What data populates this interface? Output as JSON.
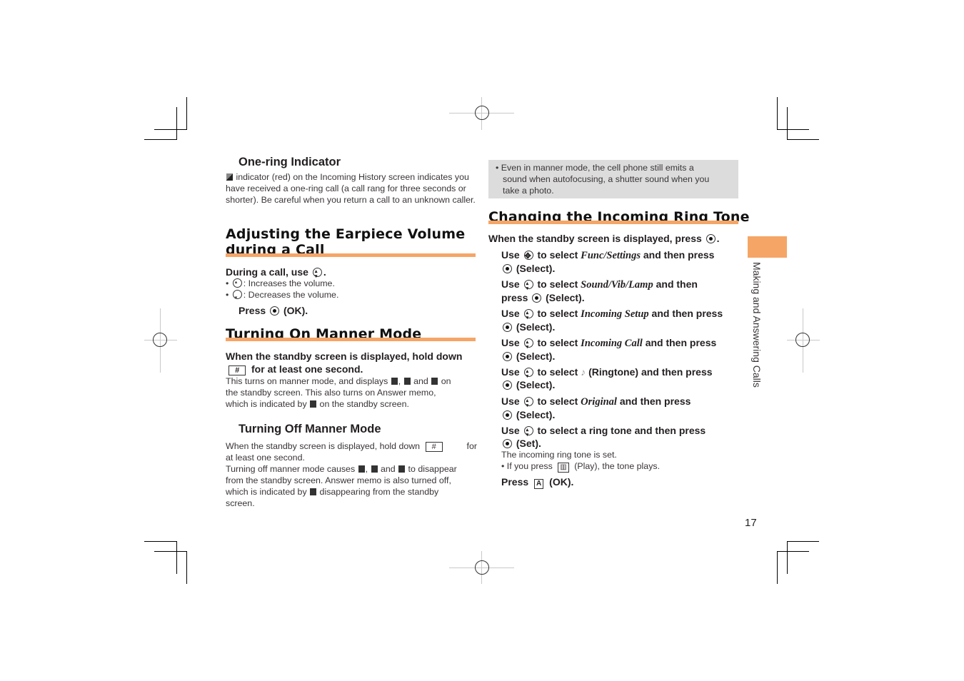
{
  "left": {
    "one_ring": {
      "title": "One-ring Indicator",
      "icon": "one-ring-indicator-icon",
      "text": "indicator (red) on the Incoming History screen indicates you have received a one-ring call (a call rang for three seconds or shorter). Be careful when you return a call to an unknown caller."
    },
    "earpiece": {
      "title_line1": "Adjusting the Earpiece Volume",
      "title_line2": "during a Call",
      "instruction_prefix": "During a call, use",
      "instruction_suffix": ".",
      "bullets": [
        {
          "icon": "up-key-icon",
          "text": ": Increases the volume."
        },
        {
          "icon": "down-key-icon",
          "text": ": Decreases the volume."
        }
      ],
      "press_prefix": "Press",
      "press_suffix": "(OK)."
    },
    "manner_on": {
      "title": "Turning On Manner Mode",
      "step_line1": "When the standby screen is displayed, hold down",
      "key": "#",
      "step_line2": "for at least one second.",
      "desc1": "This turns on manner mode, and displays",
      "desc1b": ",",
      "desc1c": "and",
      "desc1d": "on",
      "desc2": "the standby screen. This also turns on Answer memo,",
      "desc3a": "which is indicated by",
      "desc3b": "on the standby screen."
    },
    "manner_off": {
      "title": "Turning Off Manner Mode",
      "line1a": "When the standby screen is displayed, hold down",
      "key": "#",
      "line1b": "for",
      "line2": "at least one second.",
      "line3a": "Turning off manner mode causes",
      "line3b": ",",
      "line3c": "and",
      "line3d": "to disappear",
      "line4": "from the standby screen. Answer memo is also turned off,",
      "line5a": "which is indicated by",
      "line5b": "disappearing from the standby",
      "line6": "screen."
    }
  },
  "right": {
    "note": {
      "line1": "Even in manner mode, the cell phone still emits a",
      "line2": "sound when autofocusing, a shutter sound when you",
      "line3": "take a photo."
    },
    "ring_tone": {
      "title": "Changing the Incoming Ring Tone",
      "intro": "When the standby screen is displayed, press",
      "steps": [
        {
          "use": "Use",
          "mid": "to select",
          "item": "Func/Settings",
          "tail": "and then press",
          "end": "(Select)."
        },
        {
          "use": "Use",
          "mid": "to select",
          "item": "Sound/Vib/Lamp",
          "tail": "and then",
          "tail2": "press",
          "end": "(Select)."
        },
        {
          "use": "Use",
          "mid": "to select",
          "item": "Incoming Setup",
          "tail": "and then press",
          "end": "(Select)."
        },
        {
          "use": "Use",
          "mid": "to select",
          "item": "Incoming Call",
          "tail": "and then press",
          "end": "(Select)."
        },
        {
          "use": "Use",
          "mid": "to select",
          "item": "(Ringtone)",
          "tail": "and then press",
          "end": "(Select)."
        },
        {
          "use": "Use",
          "mid": "to select",
          "item": "Original",
          "tail": "and then press",
          "end": "(Select)."
        },
        {
          "use": "Use",
          "mid": "to select a ring tone and then press",
          "end": "(Set)."
        }
      ],
      "result": "The incoming ring tone is set.",
      "bullet_a": "If you press",
      "bullet_key": "Play",
      "bullet_b": "(Play), the tone plays.",
      "final_prefix": "Press",
      "final_key": "A",
      "final_suffix": "(OK)."
    }
  },
  "side_tab": {
    "label": "Making and Answering Calls",
    "color": "#f5a566"
  },
  "page_number": "17",
  "accent_color": "#f5a566"
}
